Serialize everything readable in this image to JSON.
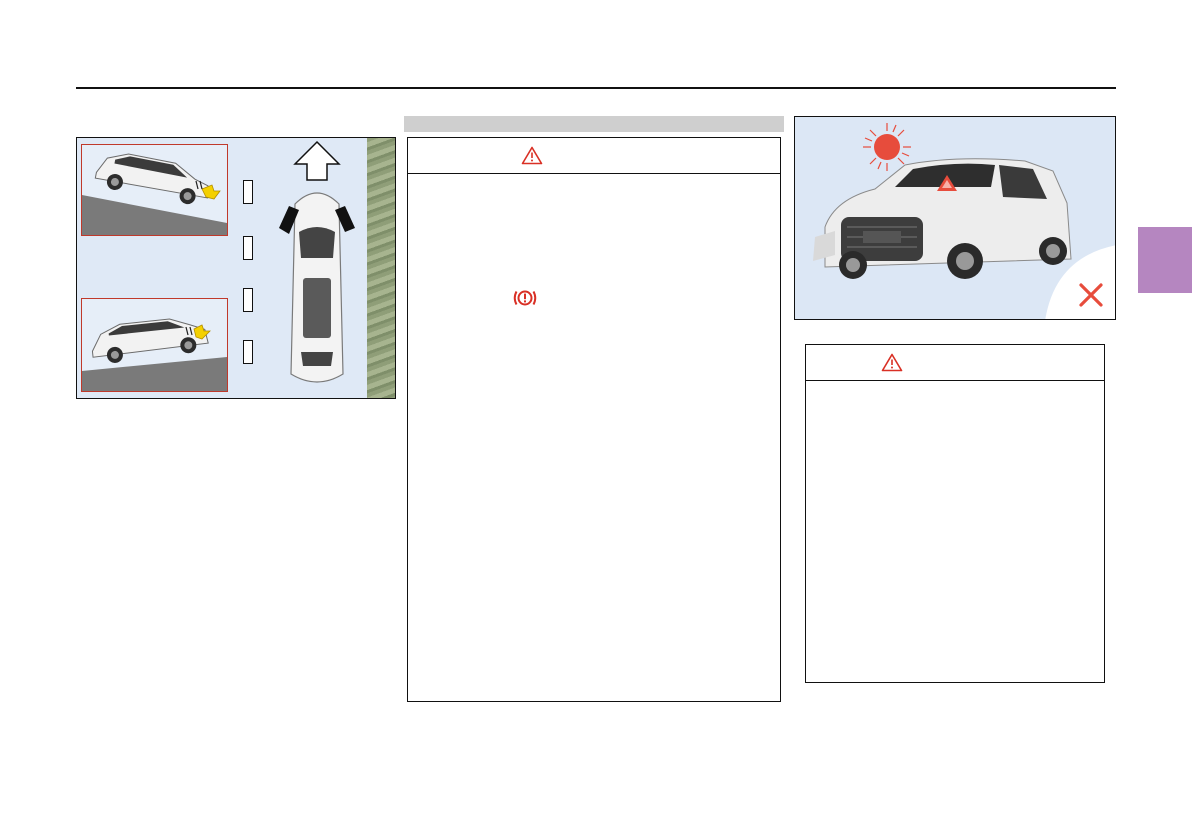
{
  "page": {
    "header_rule": true,
    "side_tab_color": "#b586c0"
  },
  "figure_parking_slopes": {
    "insets": [
      {
        "name": "uphill-parking",
        "border_color": "#c0392b"
      },
      {
        "name": "downhill-parking",
        "border_color": "#c0392b"
      }
    ],
    "icons": [
      "direction-arrow-icon",
      "curb-marker-icon",
      "wheel-chock-icon"
    ]
  },
  "middle_section": {
    "bar_color": "#cfcfcf",
    "warning_box": {
      "head_icon": "warning-triangle-icon",
      "body_icon": "parking-brake-indicator-icon",
      "accent": "#d93025"
    }
  },
  "figure_car_heat": {
    "icons": [
      "sun-icon",
      "hazard-light-icon",
      "prohibited-cross-icon"
    ],
    "accent": "#e74c3c"
  },
  "note_box": {
    "head_icon": "warning-triangle-icon"
  }
}
